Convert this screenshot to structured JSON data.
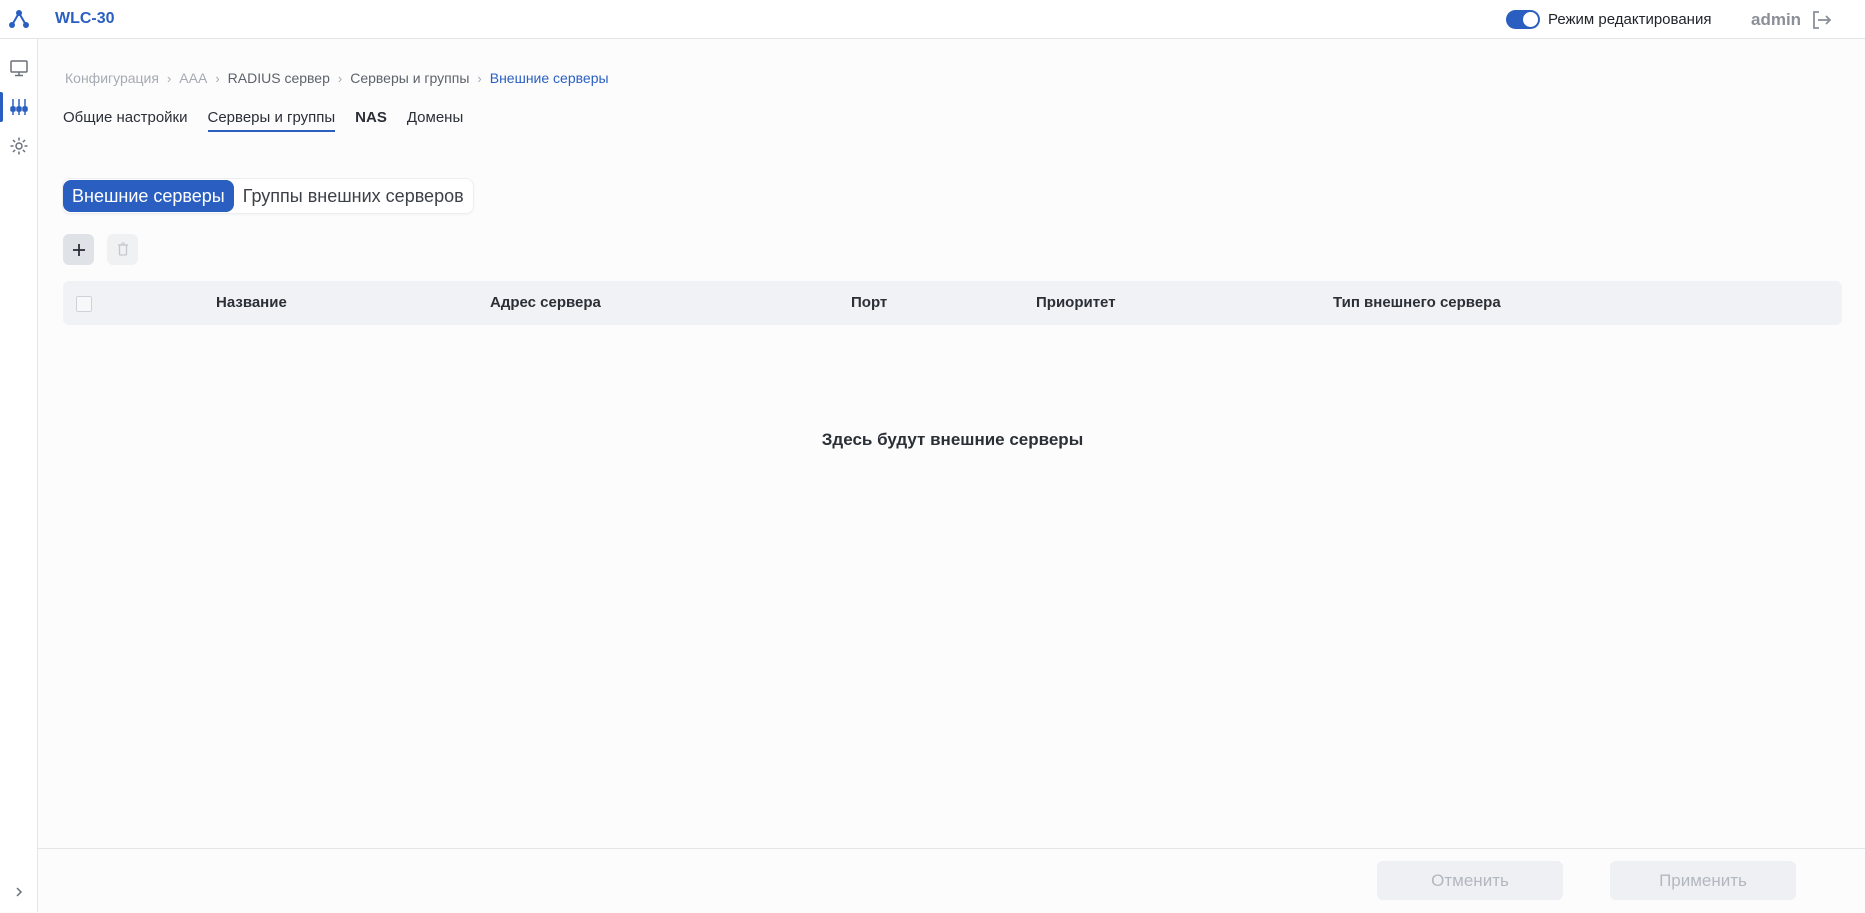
{
  "header": {
    "title": "WLC-30",
    "edit_mode_label": "Режим редактирования",
    "edit_mode_on": true,
    "user": "admin",
    "accent": "#2a5fc1"
  },
  "rail": {
    "items": [
      "monitor-icon",
      "sliders-icon",
      "gear-icon"
    ],
    "active": "sliders-icon"
  },
  "breadcrumb": [
    "Конфигурация",
    "AAA",
    "RADIUS сервер",
    "Серверы и группы",
    "Внешние серверы"
  ],
  "tabs": [
    {
      "label": "Общие настройки"
    },
    {
      "label": "Серверы и группы",
      "active": true
    },
    {
      "label": "NAS"
    },
    {
      "label": "Домены"
    }
  ],
  "segmented": {
    "active": "Внешние серверы",
    "inactive": "Группы внешних серверов"
  },
  "table": {
    "columns": [
      "Название",
      "Адрес сервера",
      "Порт",
      "Приоритет",
      "Тип внешнего сервера"
    ],
    "rows": [],
    "empty_text": "Здесь будут внешние серверы"
  },
  "footer": {
    "cancel_label": "Отменить",
    "apply_label": "Применить"
  }
}
